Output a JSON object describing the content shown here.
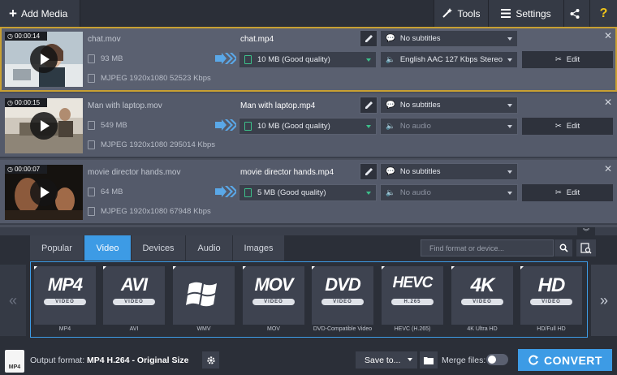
{
  "toolbar": {
    "add_media": "Add Media",
    "tools": "Tools",
    "settings": "Settings",
    "help": "?"
  },
  "files": [
    {
      "duration": "00:00:14",
      "name": "chat.mov",
      "size": "93 MB",
      "meta": "MJPEG 1920x1080 52523 Kbps",
      "output_name": "chat.mp4",
      "subtitles": "No subtitles",
      "output_size": "10 MB (Good quality)",
      "audio": "English AAC 127 Kbps Stereo",
      "edit": "Edit",
      "selected": true
    },
    {
      "duration": "00:00:15",
      "name": "Man with laptop.mov",
      "size": "549 MB",
      "meta": "MJPEG 1920x1080 295014 Kbps",
      "output_name": "Man with laptop.mp4",
      "subtitles": "No subtitles",
      "output_size": "10 MB (Good quality)",
      "audio": "No audio",
      "edit": "Edit",
      "selected": false
    },
    {
      "duration": "00:00:07",
      "name": "movie director hands.mov",
      "size": "64 MB",
      "meta": "MJPEG 1920x1080 67948 Kbps",
      "output_name": "movie director hands.mp4",
      "subtitles": "No subtitles",
      "output_size": "5 MB (Good quality)",
      "audio": "No audio",
      "edit": "Edit",
      "selected": false
    }
  ],
  "format_tabs": [
    "Popular",
    "Video",
    "Devices",
    "Audio",
    "Images"
  ],
  "active_tab": "Video",
  "search": {
    "placeholder": "Find format or device..."
  },
  "formats": [
    {
      "logo": "MP4",
      "pill": "VIDEO",
      "label": "MP4"
    },
    {
      "logo": "AVI",
      "pill": "VIDEO",
      "label": "AVI"
    },
    {
      "logo": "",
      "pill": "",
      "label": "WMV"
    },
    {
      "logo": "MOV",
      "pill": "VIDEO",
      "label": "MOV"
    },
    {
      "logo": "DVD",
      "pill": "VIDEO",
      "label": "DVD-Compatible Video"
    },
    {
      "logo": "HEVC",
      "pill": "H.265",
      "label": "HEVC (H.265)"
    },
    {
      "logo": "4K",
      "pill": "VIDEO",
      "label": "4K Ultra HD"
    },
    {
      "logo": "HD",
      "pill": "VIDEO",
      "label": "HD/Full HD"
    }
  ],
  "footer": {
    "output_label": "Output format:",
    "output_value": "MP4 H.264 - Original Size",
    "save_to": "Save to...",
    "merge_files": "Merge files:",
    "convert": "CONVERT",
    "file_icon": "MP4"
  },
  "colors": {
    "accent": "#3d9be5",
    "selected_outline": "#c8a032",
    "quality_icon": "#3cc08a"
  }
}
